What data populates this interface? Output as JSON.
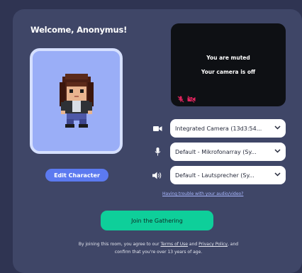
{
  "welcome": {
    "title": "Welcome, Anonymus!"
  },
  "avatar": {
    "edit_label": "Edit Character"
  },
  "video_preview": {
    "muted_text": "You are muted",
    "camera_text": "Your camera is off",
    "status_icons": [
      "mic-off-icon",
      "camera-off-icon"
    ],
    "status_color": "#e0245e"
  },
  "devices": {
    "camera": {
      "icon": "camera-icon",
      "value": "Integrated Camera (13d3:54..."
    },
    "microphone": {
      "icon": "microphone-icon",
      "value": "Default - Mikrofonarray (Sy..."
    },
    "speaker": {
      "icon": "speaker-icon",
      "value": "Default - Lautsprecher (Sy..."
    }
  },
  "help_link": "Having trouble with your audio/video?",
  "join": {
    "label": "Join the Gathering"
  },
  "legal": {
    "prefix": "By joining this room, you agree to our ",
    "terms": "Terms of Use",
    "and": " and ",
    "privacy": "Privacy Policy",
    "suffix": ", and confirm that you're over 13 years of age."
  },
  "colors": {
    "accent": "#5c7af0",
    "join": "#0ecf9a",
    "panel": "#3f4667",
    "background": "#2f3452"
  }
}
